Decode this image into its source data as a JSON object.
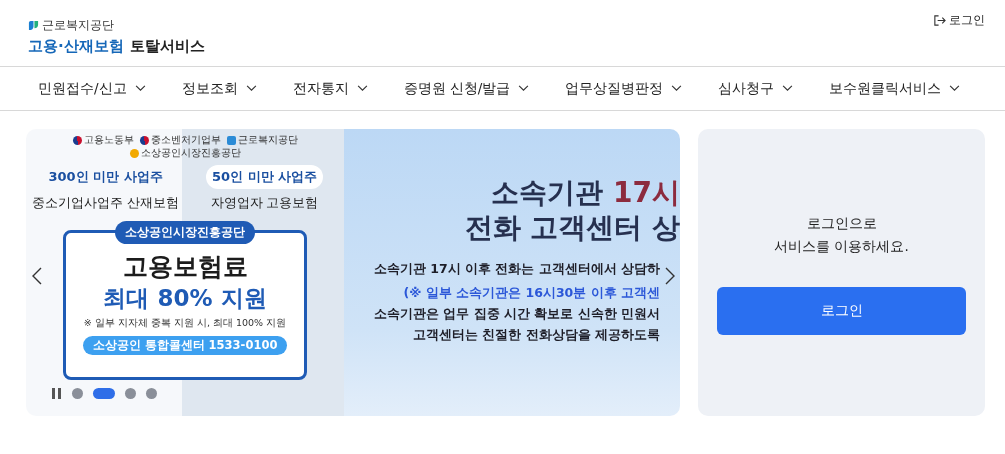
{
  "header": {
    "org": "근로복지공단",
    "title_main": "고용·산재보험",
    "title_sub": "토탈서비스",
    "login_link": "로그인"
  },
  "nav": [
    {
      "label": "민원접수/신고"
    },
    {
      "label": "정보조회"
    },
    {
      "label": "전자통지"
    },
    {
      "label": "증명원 신청/발급"
    },
    {
      "label": "업무상질병판정"
    },
    {
      "label": "심사청구"
    },
    {
      "label": "보수원클릭서비스"
    }
  ],
  "carousel": {
    "playing": true,
    "slides": [
      {
        "kind": "promo",
        "agencies": [
          "고용노동부",
          "중소벤처기업부",
          "근로복지공단",
          "소상공인시장진흥공단"
        ],
        "columns": [
          {
            "tag": "300인 미만 사업주",
            "text": "중소기업사업주 산재보험"
          },
          {
            "tag": "50인 미만 사업주",
            "text": "자영업자 고용보험"
          }
        ],
        "card": {
          "badge": "소상공인시장진흥공단",
          "headline": "고용보험료",
          "highlight": "최대 80% 지원",
          "note": "※ 일부 지자체 중복 지원 시, 최대 100% 지원",
          "contact": "소상공인 통합콜센터 1533-0100"
        }
      },
      {
        "kind": "notice",
        "title_lines": [
          [
            {
              "text": "소속기관 ",
              "accent": false
            },
            {
              "text": "17시",
              "accent": true
            }
          ],
          [
            {
              "text": "전화 고객센터 상",
              "accent": false
            }
          ]
        ],
        "lines": [
          {
            "text": "소속기관 17시 이후 전화는 고객센터에서 상담하",
            "kind": "plain"
          },
          {
            "text": "(※ 일부 소속기관은 16시30분 이후 고객센",
            "kind": "note"
          },
          {
            "text": "소속기관은 업무 집중 시간 확보로 신속한 민원서",
            "kind": "plain"
          },
          {
            "text": "고객센터는 친절한 전화상담을 제공하도록",
            "kind": "plain"
          }
        ]
      }
    ],
    "indicators": [
      {
        "selected": false
      },
      {
        "selected": true
      },
      {
        "selected": false
      },
      {
        "selected": false
      }
    ]
  },
  "login_panel": {
    "message": [
      "로그인으로",
      "서비스를 이용하세요."
    ],
    "button": "로그인"
  }
}
